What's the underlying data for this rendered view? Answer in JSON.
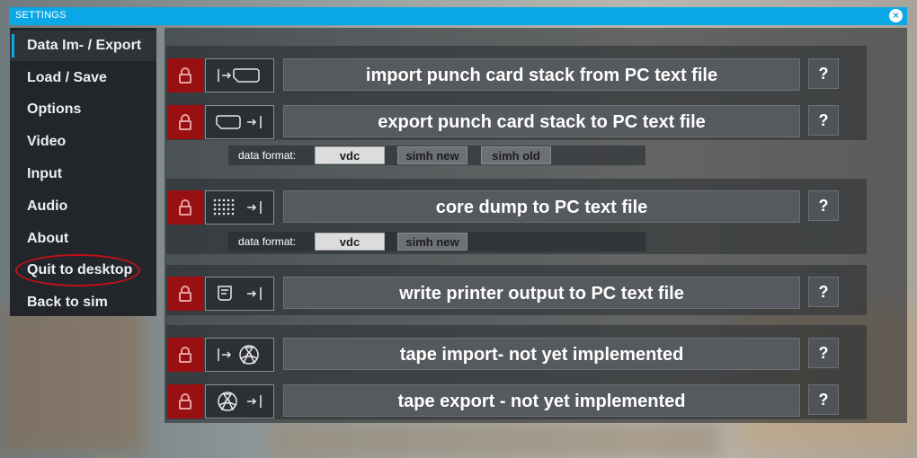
{
  "window": {
    "title": "SETTINGS",
    "close_icon": "×"
  },
  "sidebar": {
    "items": [
      {
        "label": "Data Im- / Export",
        "active": true
      },
      {
        "label": "Load / Save"
      },
      {
        "label": "Options"
      },
      {
        "label": "Video"
      },
      {
        "label": "Input"
      },
      {
        "label": "Audio"
      },
      {
        "label": "About"
      },
      {
        "label": "Quit to desktop",
        "highlighted_ring_color": "#c0101a"
      },
      {
        "label": "Back to sim"
      }
    ]
  },
  "rows": [
    {
      "icon": "import-card-icon",
      "label": "import punch card stack from PC text file",
      "help": "?"
    },
    {
      "icon": "export-card-icon",
      "label": "export punch card stack to PC text file",
      "help": "?"
    },
    {
      "icon": "core-dump-icon",
      "label": "core dump to PC text file",
      "help": "?"
    },
    {
      "icon": "printer-output-icon",
      "label": "write printer output to PC text file",
      "help": "?"
    },
    {
      "icon": "tape-import-icon",
      "label": "tape import- not yet implemented",
      "help": "?"
    },
    {
      "icon": "tape-export-icon",
      "label": "tape export - not yet implemented",
      "help": "?"
    }
  ],
  "format_cards": {
    "label": "data format:",
    "options": [
      "vdc",
      "simh new",
      "simh old"
    ],
    "selected": "vdc"
  },
  "format_core": {
    "label": "data format:",
    "options": [
      "vdc",
      "simh new"
    ],
    "selected": "vdc"
  },
  "colors": {
    "accent": "#0aa8e6",
    "lock": "#9a1012",
    "button": "#565a5e"
  }
}
